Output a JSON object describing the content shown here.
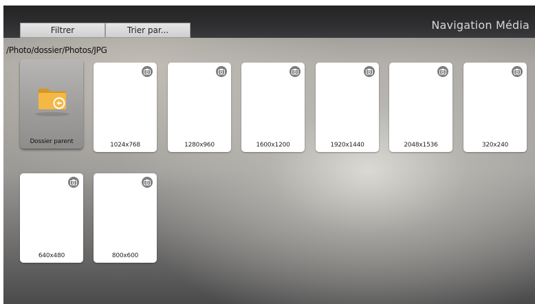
{
  "header": {
    "title": "Navigation Média",
    "filter_label": "Filtrer",
    "sort_label": "Trier par..."
  },
  "breadcrumb": {
    "path": "/Photo/dossier/Photos/JPG"
  },
  "items": [
    {
      "label": "Dossier parent",
      "type": "folder-up"
    },
    {
      "label": "1024x768",
      "type": "photo"
    },
    {
      "label": "1280x960",
      "type": "photo"
    },
    {
      "label": "1600x1200",
      "type": "photo"
    },
    {
      "label": "1920x1440",
      "type": "photo"
    },
    {
      "label": "2048x1536",
      "type": "photo"
    },
    {
      "label": "320x240",
      "type": "photo"
    },
    {
      "label": "640x480",
      "type": "photo"
    },
    {
      "label": "800x600",
      "type": "photo"
    }
  ],
  "icons": {
    "folder": "folder-back-icon",
    "photo_badge": "camera-icon"
  },
  "colors": {
    "folder": "#f0b23a",
    "badge": "#7d7d7d"
  }
}
